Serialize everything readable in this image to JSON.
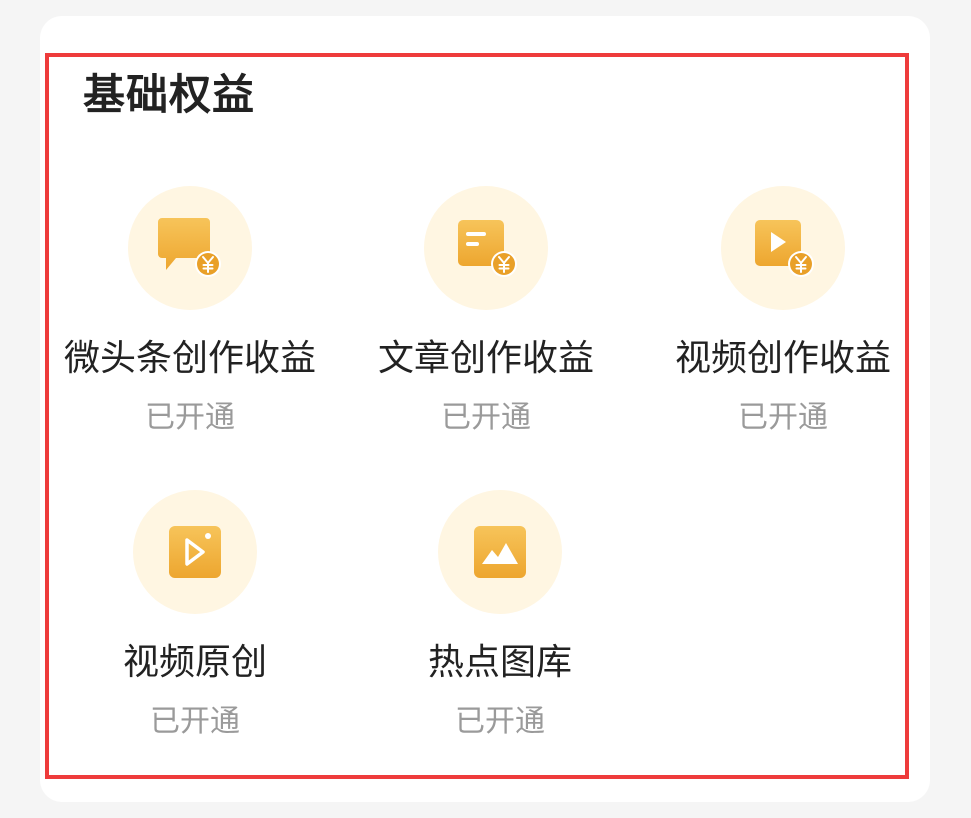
{
  "section": {
    "title": "基础权益"
  },
  "colors": {
    "highlight_border": "#ee3b3b",
    "icon_gold": "#f2b640",
    "icon_bg": "#fff6e2",
    "status_text": "#9a9a9a"
  },
  "benefits": [
    {
      "icon": "message-coin-icon",
      "label": "微头条创作收益",
      "status": "已开通"
    },
    {
      "icon": "article-coin-icon",
      "label": "文章创作收益",
      "status": "已开通"
    },
    {
      "icon": "video-coin-icon",
      "label": "视频创作收益",
      "status": "已开通"
    },
    {
      "icon": "video-original-icon",
      "label": "视频原创",
      "status": "已开通"
    },
    {
      "icon": "image-gallery-icon",
      "label": "热点图库",
      "status": "已开通"
    }
  ]
}
